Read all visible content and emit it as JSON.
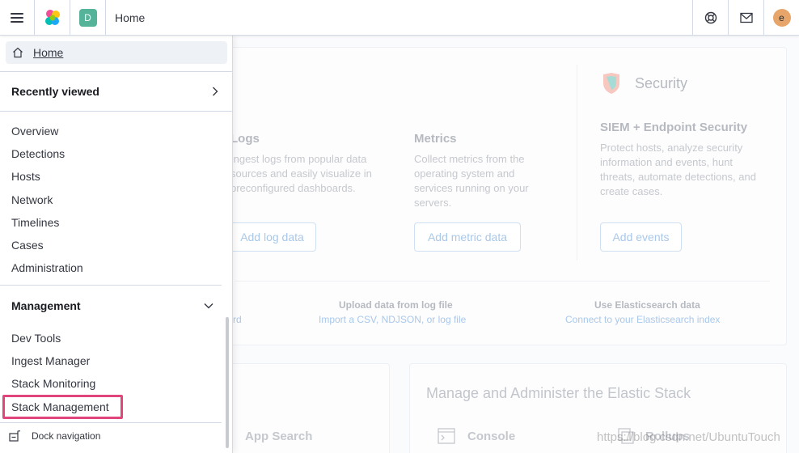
{
  "header": {
    "space_initial": "D",
    "breadcrumb": "Home",
    "user_initial": "e",
    "icons": [
      "menu-icon",
      "elastic-logo",
      "help-icon",
      "mail-icon"
    ]
  },
  "nav": {
    "home_label": "Home",
    "recently_viewed_label": "Recently viewed",
    "security_items": [
      "Overview",
      "Detections",
      "Hosts",
      "Network",
      "Timelines",
      "Cases",
      "Administration"
    ],
    "management_label": "Management",
    "management_items": [
      "Dev Tools",
      "Ingest Manager",
      "Stack Monitoring",
      "Stack Management"
    ],
    "dock_label": "Dock navigation"
  },
  "background": {
    "logs": {
      "title": "Logs",
      "desc": "Ingest logs from popular data sources and easily visualize in preconfigured dashboards.",
      "button": "Add log data"
    },
    "metrics": {
      "title": "Metrics",
      "desc": "Collect metrics from the operating system and services running on your servers.",
      "button": "Add metric data"
    },
    "security": {
      "heading": "Security",
      "title": "SIEM + Endpoint Security",
      "desc": "Protect hosts, analyze security information and events, hunt threats, automate detections, and create cases.",
      "button": "Add events"
    },
    "sample_link_tail": "rd",
    "upload": {
      "title": "Upload data from log file",
      "link": "Import a CSV, NDJSON, or log file"
    },
    "es": {
      "title": "Use Elasticsearch data",
      "link": "Connect to your Elasticsearch index"
    },
    "manage_title": "Manage and Administer the Elastic Stack",
    "app_search": "App Search",
    "console": "Console",
    "rollups": "Rollups"
  },
  "watermark": "https://blog.csdn.net/UbuntuTouch",
  "colors": {
    "highlight": "#e0457b",
    "space_badge": "#54b399",
    "avatar": "#e7a569"
  }
}
